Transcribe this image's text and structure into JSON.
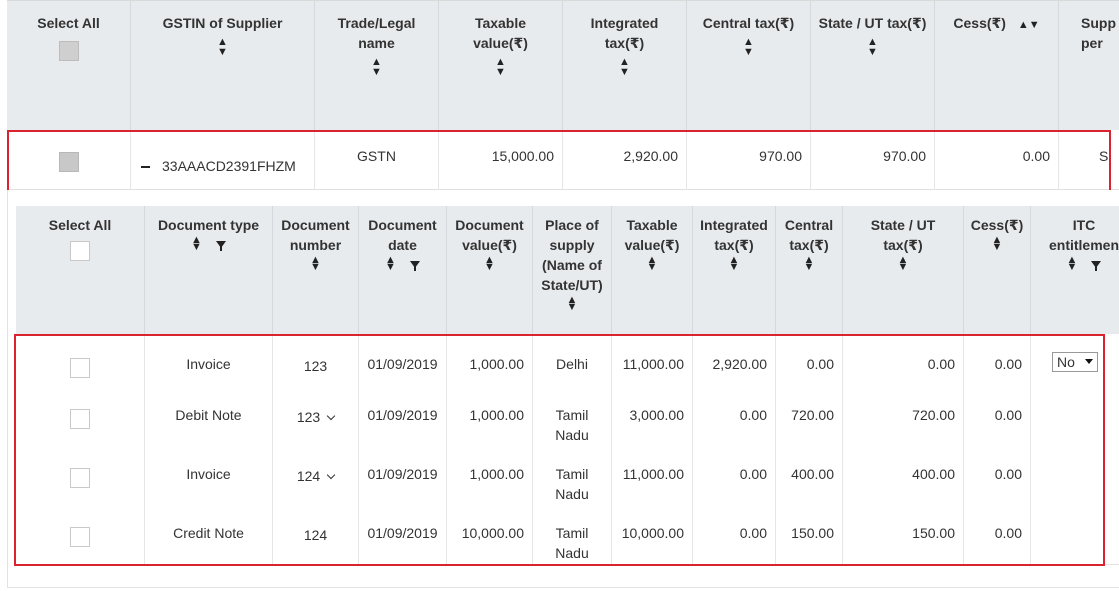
{
  "outer_table": {
    "headers": [
      {
        "label": "Select All"
      },
      {
        "label": "GSTIN of Supplier"
      },
      {
        "label": "Trade/Legal name"
      },
      {
        "label": "Taxable value(₹)"
      },
      {
        "label": "Integrated tax(₹)"
      },
      {
        "label": "Central tax(₹)"
      },
      {
        "label": "State / UT tax(₹)"
      },
      {
        "label": "Cess(₹)"
      },
      {
        "label": "Supp per"
      }
    ],
    "row": {
      "gstin": "33AAACD2391FHZM",
      "trade_name": "GSTN",
      "taxable_value": "15,000.00",
      "integrated_tax": "2,920.00",
      "central_tax": "970.00",
      "state_ut_tax": "970.00",
      "cess": "0.00",
      "supplier_period": "S"
    }
  },
  "inner_table": {
    "headers": [
      {
        "label": "Select All"
      },
      {
        "label": "Document type"
      },
      {
        "label": "Document number"
      },
      {
        "label": "Document date"
      },
      {
        "label": "Document value(₹)"
      },
      {
        "label": "Place of supply (Name of State/UT)"
      },
      {
        "label": "Taxable value(₹)"
      },
      {
        "label": "Integrated tax(₹)"
      },
      {
        "label": "Central tax(₹)"
      },
      {
        "label": "State / UT tax(₹)"
      },
      {
        "label": "Cess(₹)"
      },
      {
        "label": "ITC entitlemen"
      }
    ],
    "rows": [
      {
        "doc_type": "Invoice",
        "doc_number": "123",
        "doc_date": "01/09/2019",
        "doc_value": "1,000.00",
        "place": "Delhi",
        "taxable": "11,000.00",
        "igst": "2,920.00",
        "cgst": "0.00",
        "sgst": "0.00",
        "cess": "0.00",
        "itc": "No"
      },
      {
        "doc_type": "Debit Note",
        "doc_number": "123",
        "doc_date": "01/09/2019",
        "doc_value": "1,000.00",
        "place": "Tamil Nadu",
        "taxable": "3,000.00",
        "igst": "0.00",
        "cgst": "720.00",
        "sgst": "720.00",
        "cess": "0.00",
        "itc": ""
      },
      {
        "doc_type": "Invoice",
        "doc_number": "124",
        "doc_date": "01/09/2019",
        "doc_value": "1,000.00",
        "place": "Tamil Nadu",
        "taxable": "11,000.00",
        "igst": "0.00",
        "cgst": "400.00",
        "sgst": "400.00",
        "cess": "0.00",
        "itc": ""
      },
      {
        "doc_type": "Credit Note",
        "doc_number": "124",
        "doc_date": "01/09/2019",
        "doc_value": "10,000.00",
        "place": "Tamil Nadu",
        "taxable": "10,000.00",
        "igst": "0.00",
        "cgst": "150.00",
        "sgst": "150.00",
        "cess": "0.00",
        "itc": ""
      }
    ]
  },
  "colors": {
    "header_bg": "#e8ebee",
    "highlight_border": "#d9232e"
  }
}
